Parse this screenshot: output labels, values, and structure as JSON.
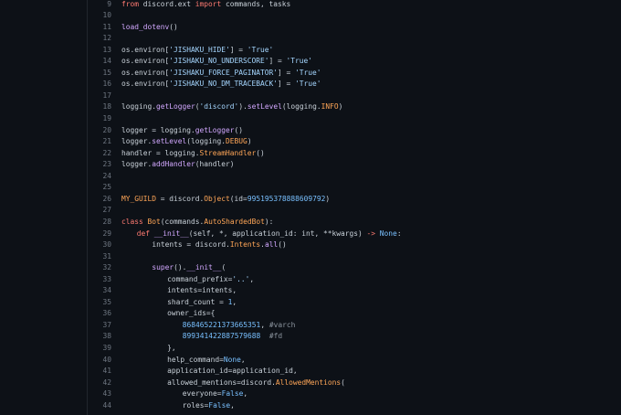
{
  "colors": {
    "background": "#0d1117",
    "line_number": "#6e7681",
    "text": "#c9d1d9",
    "keyword": "#ff7b72",
    "string": "#a5d6ff",
    "function": "#d2a8ff",
    "class": "#ffa657",
    "constant": "#79c0ff",
    "comment": "#8b949e"
  },
  "editor": {
    "lines": [
      {
        "n": "9",
        "indent": 0,
        "tokens": [
          [
            "kw",
            "from"
          ],
          [
            "txt",
            " discord.ext "
          ],
          [
            "kw",
            "import"
          ],
          [
            "txt",
            " commands, tasks"
          ]
        ]
      },
      {
        "n": "10",
        "indent": 0,
        "tokens": []
      },
      {
        "n": "11",
        "indent": 0,
        "tokens": [
          [
            "fn",
            "load_dotenv"
          ],
          [
            "txt",
            "()"
          ]
        ]
      },
      {
        "n": "12",
        "indent": 0,
        "tokens": []
      },
      {
        "n": "13",
        "indent": 0,
        "tokens": [
          [
            "txt",
            "os.environ["
          ],
          [
            "str",
            "'JISHAKU_HIDE'"
          ],
          [
            "txt",
            "] = "
          ],
          [
            "str",
            "'True'"
          ]
        ]
      },
      {
        "n": "14",
        "indent": 0,
        "tokens": [
          [
            "txt",
            "os.environ["
          ],
          [
            "str",
            "'JISHAKU_NO_UNDERSCORE'"
          ],
          [
            "txt",
            "] = "
          ],
          [
            "str",
            "'True'"
          ]
        ]
      },
      {
        "n": "15",
        "indent": 0,
        "tokens": [
          [
            "txt",
            "os.environ["
          ],
          [
            "str",
            "'JISHAKU_FORCE_PAGINATOR'"
          ],
          [
            "txt",
            "] = "
          ],
          [
            "str",
            "'True'"
          ]
        ]
      },
      {
        "n": "16",
        "indent": 0,
        "tokens": [
          [
            "txt",
            "os.environ["
          ],
          [
            "str",
            "'JISHAKU_NO_DM_TRACEBACK'"
          ],
          [
            "txt",
            "] = "
          ],
          [
            "str",
            "'True'"
          ]
        ]
      },
      {
        "n": "17",
        "indent": 0,
        "tokens": []
      },
      {
        "n": "18",
        "indent": 0,
        "tokens": [
          [
            "txt",
            "logging."
          ],
          [
            "fn",
            "getLogger"
          ],
          [
            "txt",
            "("
          ],
          [
            "str",
            "'discord'"
          ],
          [
            "txt",
            ")."
          ],
          [
            "fn",
            "setLevel"
          ],
          [
            "txt",
            "(logging."
          ],
          [
            "cls",
            "INFO"
          ],
          [
            "txt",
            ")"
          ]
        ]
      },
      {
        "n": "19",
        "indent": 0,
        "tokens": []
      },
      {
        "n": "20",
        "indent": 0,
        "tokens": [
          [
            "txt",
            "logger = logging."
          ],
          [
            "fn",
            "getLogger"
          ],
          [
            "txt",
            "()"
          ]
        ]
      },
      {
        "n": "21",
        "indent": 0,
        "tokens": [
          [
            "txt",
            "logger."
          ],
          [
            "fn",
            "setLevel"
          ],
          [
            "txt",
            "(logging."
          ],
          [
            "cls",
            "DEBUG"
          ],
          [
            "txt",
            ")"
          ]
        ]
      },
      {
        "n": "22",
        "indent": 0,
        "tokens": [
          [
            "txt",
            "handler = logging."
          ],
          [
            "cls",
            "StreamHandler"
          ],
          [
            "txt",
            "()"
          ]
        ]
      },
      {
        "n": "23",
        "indent": 0,
        "tokens": [
          [
            "txt",
            "logger."
          ],
          [
            "fn",
            "addHandler"
          ],
          [
            "txt",
            "(handler)"
          ]
        ]
      },
      {
        "n": "24",
        "indent": 0,
        "tokens": []
      },
      {
        "n": "25",
        "indent": 0,
        "tokens": []
      },
      {
        "n": "26",
        "indent": 0,
        "tokens": [
          [
            "cls",
            "MY_GUILD"
          ],
          [
            "txt",
            " = discord."
          ],
          [
            "cls",
            "Object"
          ],
          [
            "txt",
            "(id="
          ],
          [
            "const",
            "995195378888609792"
          ],
          [
            "txt",
            ")"
          ]
        ]
      },
      {
        "n": "27",
        "indent": 0,
        "tokens": []
      },
      {
        "n": "28",
        "indent": 0,
        "tokens": [
          [
            "kw",
            "class"
          ],
          [
            "txt",
            " "
          ],
          [
            "cls",
            "Bot"
          ],
          [
            "txt",
            "(commands."
          ],
          [
            "cls",
            "AutoShardedBot"
          ],
          [
            "txt",
            "):"
          ]
        ]
      },
      {
        "n": "29",
        "indent": 1,
        "tokens": [
          [
            "kw",
            "def"
          ],
          [
            "txt",
            " "
          ],
          [
            "fn",
            "__init__"
          ],
          [
            "txt",
            "(self, *, application_id: int, **kwargs) "
          ],
          [
            "kw",
            "->"
          ],
          [
            "txt",
            " "
          ],
          [
            "const",
            "None"
          ],
          [
            "txt",
            ":"
          ]
        ]
      },
      {
        "n": "30",
        "indent": 2,
        "tokens": [
          [
            "txt",
            "intents = discord."
          ],
          [
            "cls",
            "Intents"
          ],
          [
            "txt",
            "."
          ],
          [
            "fn",
            "all"
          ],
          [
            "txt",
            "()"
          ]
        ]
      },
      {
        "n": "31",
        "indent": 0,
        "tokens": []
      },
      {
        "n": "32",
        "indent": 2,
        "tokens": [
          [
            "fn",
            "super"
          ],
          [
            "txt",
            "()."
          ],
          [
            "fn",
            "__init__"
          ],
          [
            "txt",
            "("
          ]
        ]
      },
      {
        "n": "33",
        "indent": 3,
        "tokens": [
          [
            "txt",
            "command_prefix="
          ],
          [
            "str",
            "'..'"
          ],
          [
            "txt",
            ","
          ]
        ]
      },
      {
        "n": "34",
        "indent": 3,
        "tokens": [
          [
            "txt",
            "intents=intents,"
          ]
        ]
      },
      {
        "n": "35",
        "indent": 3,
        "tokens": [
          [
            "txt",
            "shard_count = "
          ],
          [
            "const",
            "1"
          ],
          [
            "txt",
            ","
          ]
        ]
      },
      {
        "n": "36",
        "indent": 3,
        "tokens": [
          [
            "txt",
            "owner_ids={"
          ]
        ]
      },
      {
        "n": "37",
        "indent": 4,
        "tokens": [
          [
            "const",
            "868465221373665351"
          ],
          [
            "txt",
            ", "
          ],
          [
            "com",
            "#varch"
          ]
        ]
      },
      {
        "n": "38",
        "indent": 4,
        "tokens": [
          [
            "const",
            "899341422887579688"
          ],
          [
            "txt",
            "  "
          ],
          [
            "com",
            "#fd"
          ]
        ]
      },
      {
        "n": "39",
        "indent": 3,
        "tokens": [
          [
            "txt",
            "},"
          ]
        ]
      },
      {
        "n": "40",
        "indent": 3,
        "tokens": [
          [
            "txt",
            "help_command="
          ],
          [
            "const",
            "None"
          ],
          [
            "txt",
            ","
          ]
        ]
      },
      {
        "n": "41",
        "indent": 3,
        "tokens": [
          [
            "txt",
            "application_id=application_id,"
          ]
        ]
      },
      {
        "n": "42",
        "indent": 3,
        "tokens": [
          [
            "txt",
            "allowed_mentions=discord."
          ],
          [
            "cls",
            "AllowedMentions"
          ],
          [
            "txt",
            "("
          ]
        ]
      },
      {
        "n": "43",
        "indent": 4,
        "tokens": [
          [
            "txt",
            "everyone="
          ],
          [
            "const",
            "False"
          ],
          [
            "txt",
            ","
          ]
        ]
      },
      {
        "n": "44",
        "indent": 4,
        "tokens": [
          [
            "txt",
            "roles="
          ],
          [
            "const",
            "False"
          ],
          [
            "txt",
            ","
          ]
        ]
      }
    ]
  }
}
